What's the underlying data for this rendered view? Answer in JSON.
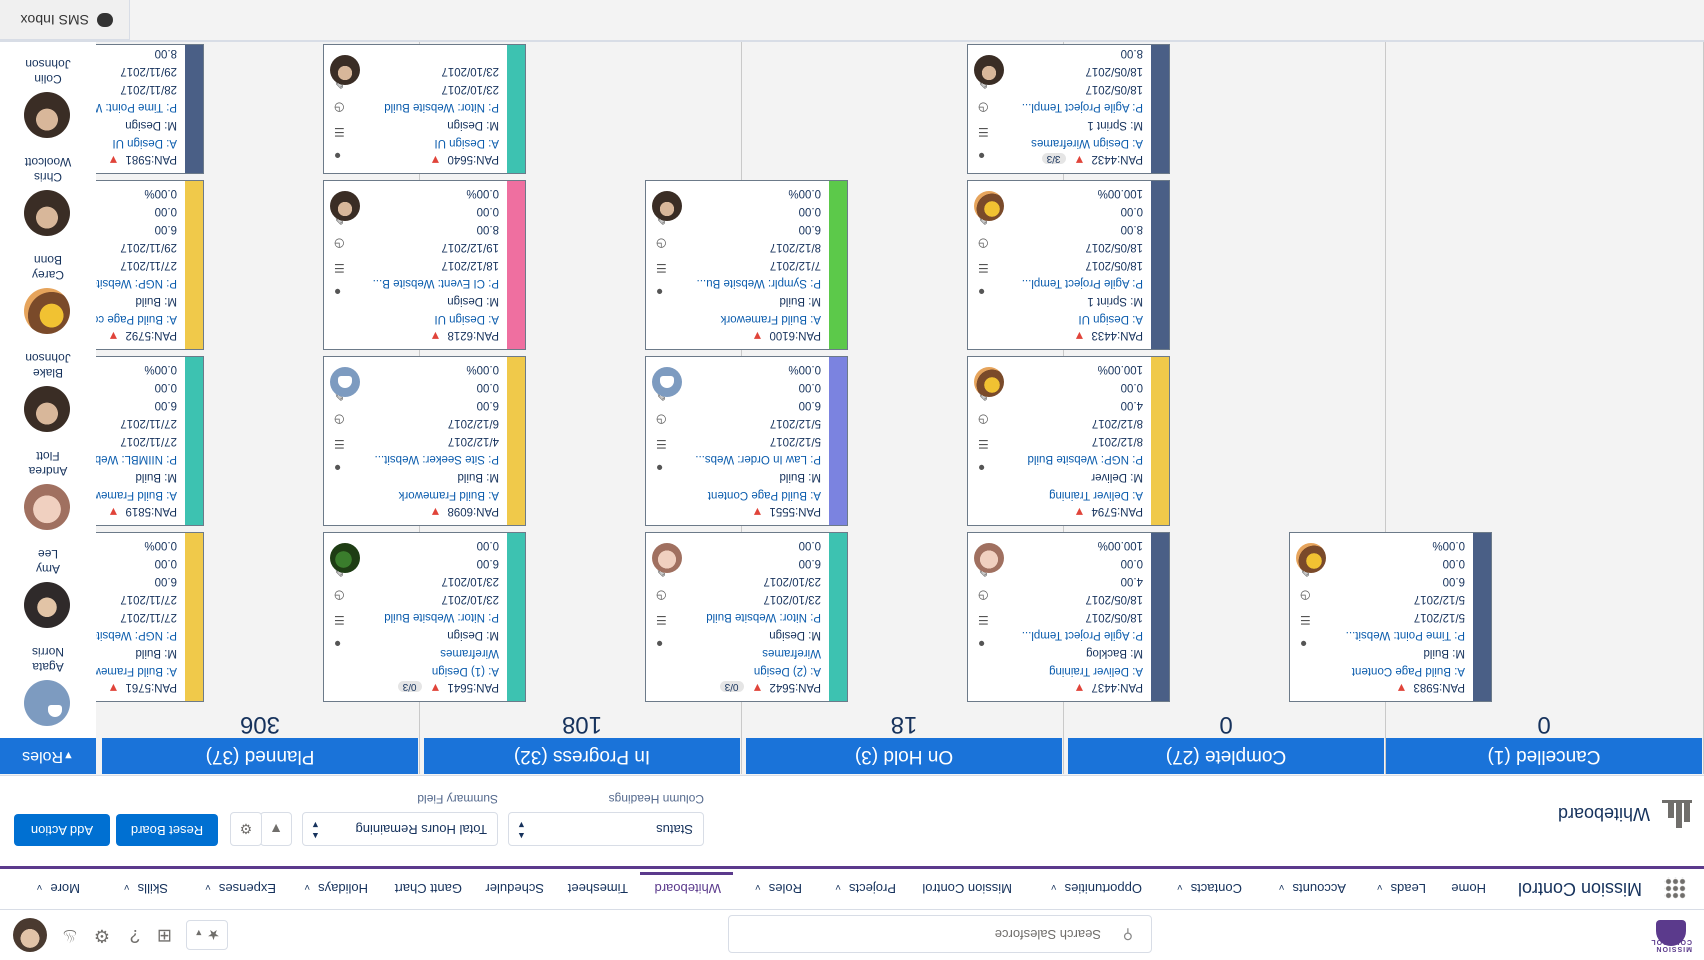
{
  "global_header": {
    "logo_text": "MISSION CONTROL",
    "search_placeholder": "Search Salesforce"
  },
  "nav": {
    "app_name": "Mission Control",
    "items": [
      {
        "label": "Home",
        "chevron": false
      },
      {
        "label": "Leads",
        "chevron": true
      },
      {
        "label": "Accounts",
        "chevron": true
      },
      {
        "label": "Contacts",
        "chevron": true
      },
      {
        "label": "Opportunities",
        "chevron": true
      },
      {
        "label": "Mission Control",
        "chevron": false
      },
      {
        "label": "Projects",
        "chevron": true
      },
      {
        "label": "Roles",
        "chevron": true
      },
      {
        "label": "Whiteboard",
        "chevron": false,
        "active": true
      },
      {
        "label": "Timesheet",
        "chevron": false
      },
      {
        "label": "Scheduler",
        "chevron": false
      },
      {
        "label": "Gantt Chart",
        "chevron": false
      },
      {
        "label": "Holidays",
        "chevron": true
      },
      {
        "label": "Expenses",
        "chevron": true
      },
      {
        "label": "Skills",
        "chevron": true
      },
      {
        "label": "More",
        "chevron": true
      }
    ]
  },
  "page_header": {
    "title": "Whiteboard",
    "column_headings_value": "Status",
    "column_headings_label": "Column Headings",
    "summary_field_value": "Total Hours Remaining",
    "summary_field_label": "Summary Field",
    "reset_label": "Reset Board",
    "add_action_label": "Add Action"
  },
  "colors": {
    "header_blue": "#1a73d9",
    "nav_accent": "#5b3a8c",
    "button_blue": "#0070d2",
    "priority_red": "#e0443a"
  },
  "columns": [
    {
      "label": "Planned (37)",
      "total": "306"
    },
    {
      "label": "In Progress (32)",
      "total": "108"
    },
    {
      "label": "On Hold (3)",
      "total": "18"
    },
    {
      "label": "Complete (27)",
      "total": "0"
    },
    {
      "label": "Cancelled (1)",
      "total": "0"
    }
  ],
  "cards": [
    {
      "col": 0,
      "id": "PAN:5761",
      "checklist": "",
      "action": "A: Build Framework",
      "milestone": "M: Build",
      "project": "P: NGP: Website Build",
      "date1": "27/11/2017",
      "date2": "27/11/2017",
      "hours": "6.00",
      "remaining": "0.00",
      "percent": "0.00%",
      "color": "#f0c94a",
      "avatar": "ph3"
    },
    {
      "col": 0,
      "id": "PAN:5819",
      "checklist": "",
      "action": "A: Build Framework",
      "milestone": "M: Build",
      "project": "P: NIIMBL: Website B...",
      "date1": "27/11/2017",
      "date2": "27/11/2017",
      "hours": "6.00",
      "remaining": "0.00",
      "percent": "0.00%",
      "color": "#3dc2b1",
      "avatar": "default"
    },
    {
      "col": 0,
      "id": "PAN:5792",
      "checklist": "",
      "action": "A: Build Page content",
      "milestone": "M: Build",
      "project": "P: NGP: Website Build",
      "date1": "27/11/2017",
      "date2": "29/11/2017",
      "hours": "6.00",
      "remaining": "0.00",
      "percent": "0.00%",
      "color": "#f0c94a",
      "avatar": "ph2"
    },
    {
      "col": 0,
      "id": "PAN:5981",
      "checklist": "",
      "action": "A: Design UI",
      "milestone": "M: Design",
      "project": "P: Time Point: Websit...",
      "date1": "28/11/2017",
      "date2": "29/11/2017",
      "hours": "8.00",
      "remaining": "",
      "percent": "",
      "color": "#4a5f86",
      "avatar": "default"
    },
    {
      "col": 1,
      "id": "PAN:5641",
      "checklist": "0/3",
      "action": "A: (1) Design",
      "milestone": "Wireframes",
      "project": "M: Design",
      "date1": "P: Nitor: Website Build",
      "date2": "23/10/2017",
      "hours": "23/10/2017",
      "remaining": "6.00",
      "percent": "0.00",
      "percent2": "0.00%",
      "color": "#3dc2b1",
      "avatar": "ph4",
      "seven": true
    },
    {
      "col": 1,
      "id": "PAN:6098",
      "checklist": "",
      "action": "A: Build Framework",
      "milestone": "M: Build",
      "project": "P: Site Seeker: Websit...",
      "date1": "4/12/2017",
      "date2": "6/12/2017",
      "hours": "6.00",
      "remaining": "0.00",
      "percent": "0.00%",
      "color": "#f0c94a",
      "avatar": "default"
    },
    {
      "col": 1,
      "id": "PAN:6218",
      "checklist": "",
      "action": "A: Design UI",
      "milestone": "M: Design",
      "project": "P: CI Event: Website B...",
      "date1": "18/12/2017",
      "date2": "19/12/2017",
      "hours": "8.00",
      "remaining": "0.00",
      "percent": "0.00%",
      "color": "#ef6fa0",
      "avatar": "ph1"
    },
    {
      "col": 1,
      "id": "PAN:5640",
      "checklist": "",
      "action": "A: Design UI",
      "milestone": "M: Design",
      "project": "P: Nitor: Website Build",
      "date1": "23/10/2017",
      "date2": "23/10/2017",
      "hours": "",
      "remaining": "",
      "percent": "",
      "color": "#3dc2b1",
      "avatar": "ph1"
    },
    {
      "col": 2,
      "id": "PAN:5642",
      "checklist": "0/3",
      "action": "A: (2) Design",
      "milestone": "Wireframes",
      "project": "M: Design",
      "date1": "P: Nitor: Website Build",
      "date2": "23/10/2017",
      "hours": "23/10/2017",
      "remaining": "6.00",
      "percent": "0.00",
      "percent2": "0.00%",
      "color": "#3dc2b1",
      "avatar": "ph5",
      "seven": true
    },
    {
      "col": 2,
      "id": "PAN:5551",
      "checklist": "",
      "action": "A: Build Page Content",
      "milestone": "M: Build",
      "project": "P: Law In Order: Webs...",
      "date1": "5/12/2017",
      "date2": "5/12/2017",
      "hours": "6.00",
      "remaining": "0.00",
      "percent": "0.00%",
      "color": "#7b83e0",
      "avatar": "default"
    },
    {
      "col": 2,
      "id": "PAN:6100",
      "checklist": "",
      "action": "A: Build Framework",
      "milestone": "M: Build",
      "project": "P: Symplr: Website Bu...",
      "date1": "7/12/2017",
      "date2": "8/12/2017",
      "hours": "6.00",
      "remaining": "0.00",
      "percent": "0.00%",
      "color": "#5cc94a",
      "avatar": "ph1"
    },
    {
      "col": 3,
      "id": "PAN:4437",
      "checklist": "",
      "action": "A: Deliver Training",
      "milestone": "M: Backlog",
      "project": "P: Agile Project Templ...",
      "date1": "18/05/2017",
      "date2": "18/05/2017",
      "hours": "4.00",
      "remaining": "0.00",
      "percent": "100.00%",
      "color": "#4a5f86",
      "avatar": "ph5"
    },
    {
      "col": 3,
      "id": "PAN:5794",
      "checklist": "",
      "action": "A: Deliver Training",
      "milestone": "M: Deliver",
      "project": "P: NGP: Website Build",
      "date1": "8/12/2017",
      "date2": "8/12/2017",
      "hours": "4.00",
      "remaining": "0.00",
      "percent": "100.00%",
      "color": "#f0c94a",
      "avatar": "ph2"
    },
    {
      "col": 3,
      "id": "PAN:4433",
      "checklist": "",
      "action": "A: Design UI",
      "milestone": "M: Sprint 1",
      "project": "P: Agile Project Templ...",
      "date1": "18/05/2017",
      "date2": "18/05/2017",
      "hours": "8.00",
      "remaining": "0.00",
      "percent": "100.00%",
      "color": "#4a5f86",
      "avatar": "ph2"
    },
    {
      "col": 3,
      "id": "PAN:4432",
      "checklist": "3/3",
      "action": "A: Design Wireframes",
      "milestone": "M: Sprint 1",
      "project": "P: Agile Project Templ...",
      "date1": "18/05/2017",
      "date2": "18/05/2017",
      "hours": "8.00",
      "remaining": "",
      "percent": "",
      "color": "#4a5f86",
      "avatar": "ph1"
    },
    {
      "col": 4,
      "id": "PAN:5983",
      "checklist": "",
      "action": "A: Build Page Content",
      "milestone": "M: Build",
      "project": "P: Time Point: Websit...",
      "date1": "5/12/2017",
      "date2": "5/12/2017",
      "hours": "6.00",
      "remaining": "0.00",
      "percent": "0.00%",
      "color": "#4a5f86",
      "avatar": "ph2"
    }
  ],
  "roles": {
    "header": "Roles",
    "people": [
      {
        "first": "Agata",
        "last": "Norris",
        "style": "default"
      },
      {
        "first": "Amy",
        "last": "Lee",
        "style": "ph3"
      },
      {
        "first": "Andrea",
        "last": "Flott",
        "style": "ph5"
      },
      {
        "first": "Blake",
        "last": "Johnson",
        "style": "ph1"
      },
      {
        "first": "Carey",
        "last": "Bonn",
        "style": "ph2"
      },
      {
        "first": "Chris",
        "last": "Woolcott",
        "style": "ph1"
      },
      {
        "first": "Colin",
        "last": "Johnson",
        "style": "ph1"
      }
    ]
  },
  "sms": {
    "label": "SMS Inbox"
  }
}
